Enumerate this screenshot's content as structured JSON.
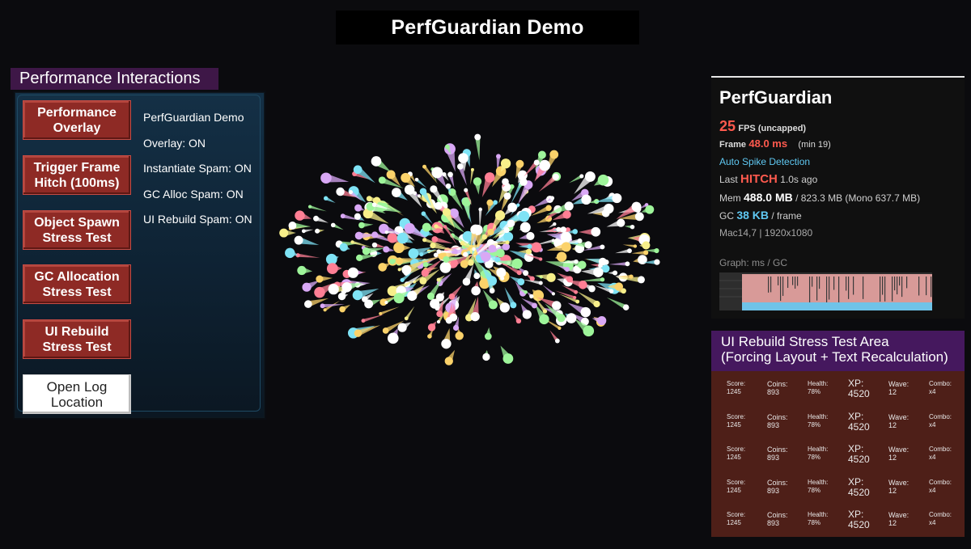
{
  "app_title": "PerfGuardian Demo",
  "interactions": {
    "header": "Performance Interactions",
    "buttons": [
      {
        "line1": "Performance",
        "line2": "Overlay"
      },
      {
        "line1": "Trigger Frame",
        "line2": "Hitch (100ms)"
      },
      {
        "line1": "Object Spawn",
        "line2": "Stress Test"
      },
      {
        "line1": "GC Allocation",
        "line2": "Stress Test"
      },
      {
        "line1": "UI Rebuild",
        "line2": "Stress Test"
      },
      {
        "line1": "Open Log",
        "line2": "Location"
      }
    ],
    "status": [
      "PerfGuardian Demo",
      "Overlay: ON",
      "Instantiate Spam: ON",
      "GC Alloc Spam: ON",
      "UI Rebuild Spam: ON"
    ]
  },
  "overlay": {
    "title": "PerfGuardian",
    "fps_value": "25",
    "fps_label": "FPS (uncapped)",
    "frame_label": "Frame",
    "frame_value": "48.0 ms",
    "frame_min": "(min 19)",
    "spike_detection": "Auto Spike Detection",
    "last_label": "Last",
    "last_value": "HITCH",
    "last_ago": "1.0s ago",
    "mem_label": "Mem",
    "mem_value": "488.0 MB",
    "mem_rest": "/ 823.3 MB  (Mono 637.7 MB)",
    "gc_label": "GC",
    "gc_value": "38 KB",
    "gc_unit": "/ frame",
    "device": "Mac14,7 | 1920x1080",
    "graph_label": "Graph: ms / GC"
  },
  "ui_rebuild": {
    "header_line1": "UI Rebuild Stress Test Area",
    "header_line2": "(Forcing Layout + Text Recalculation)",
    "rows": [
      {
        "score_label": "Score:",
        "score": "1245",
        "coins_label": "Coins:",
        "coins": "893",
        "health_label": "Health:",
        "health": "78%",
        "xp_label": "XP:",
        "xp": "4520",
        "wave_label": "Wave:",
        "wave": "12",
        "combo_label": "Combo:",
        "combo": "x4"
      },
      {
        "score_label": "Score:",
        "score": "1245",
        "coins_label": "Coins:",
        "coins": "893",
        "health_label": "Health:",
        "health": "78%",
        "xp_label": "XP:",
        "xp": "4520",
        "wave_label": "Wave:",
        "wave": "12",
        "combo_label": "Combo:",
        "combo": "x4"
      },
      {
        "score_label": "Score:",
        "score": "1245",
        "coins_label": "Coins:",
        "coins": "893",
        "health_label": "Health:",
        "health": "78%",
        "xp_label": "XP:",
        "xp": "4520",
        "wave_label": "Wave:",
        "wave": "12",
        "combo_label": "Combo:",
        "combo": "x4"
      },
      {
        "score_label": "Score:",
        "score": "1245",
        "coins_label": "Coins:",
        "coins": "893",
        "health_label": "Health:",
        "health": "78%",
        "xp_label": "XP:",
        "xp": "4520",
        "wave_label": "Wave:",
        "wave": "12",
        "combo_label": "Combo:",
        "combo": "x4"
      },
      {
        "score_label": "Score:",
        "score": "1245",
        "coins_label": "Coins:",
        "coins": "893",
        "health_label": "Health:",
        "health": "78%",
        "xp_label": "XP:",
        "xp": "4520",
        "wave_label": "Wave:",
        "wave": "12",
        "combo_label": "Combo:",
        "combo": "x4"
      }
    ]
  },
  "colors": {
    "button_red": "#8e2a25",
    "fps_red": "#ff5a4e",
    "accent_blue": "#5fc8f2",
    "header_purple": "#45185e",
    "ui_area_brown": "#4e1f18",
    "particles": [
      "#ffffff",
      "#7fe3f5",
      "#f7ef8a",
      "#d9a8f5",
      "#ff7f94",
      "#9ef59a",
      "#fbd26a"
    ]
  }
}
